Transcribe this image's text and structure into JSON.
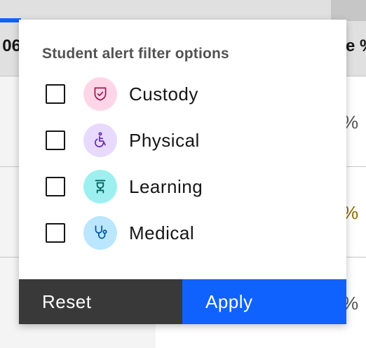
{
  "background_table": {
    "header_left_partial": "06",
    "header_right_partial": "e %",
    "rows": [
      {
        "value": "%",
        "tone": "normal"
      },
      {
        "value": "%",
        "tone": "warn"
      },
      {
        "value": "%",
        "tone": "normal"
      }
    ]
  },
  "filter_popover": {
    "title": "Student alert filter options",
    "options": [
      {
        "label": "Custody",
        "icon": "shield-icon",
        "icon_bg": "#ffd6e8",
        "icon_color": "#9f1853",
        "checked": false
      },
      {
        "label": "Physical",
        "icon": "accessibility-icon",
        "icon_bg": "#e8daff",
        "icon_color": "#6929c4",
        "checked": false
      },
      {
        "label": "Learning",
        "icon": "learning-icon",
        "icon_bg": "#9ef0f0",
        "icon_color": "#005d5d",
        "checked": false
      },
      {
        "label": "Medical",
        "icon": "stethoscope-icon",
        "icon_bg": "#bae6ff",
        "icon_color": "#00539a",
        "checked": false
      }
    ],
    "reset_label": "Reset",
    "apply_label": "Apply"
  },
  "colors": {
    "accent": "#0f62fe",
    "dark_button": "#393939",
    "warning_text": "#8e6a00"
  }
}
